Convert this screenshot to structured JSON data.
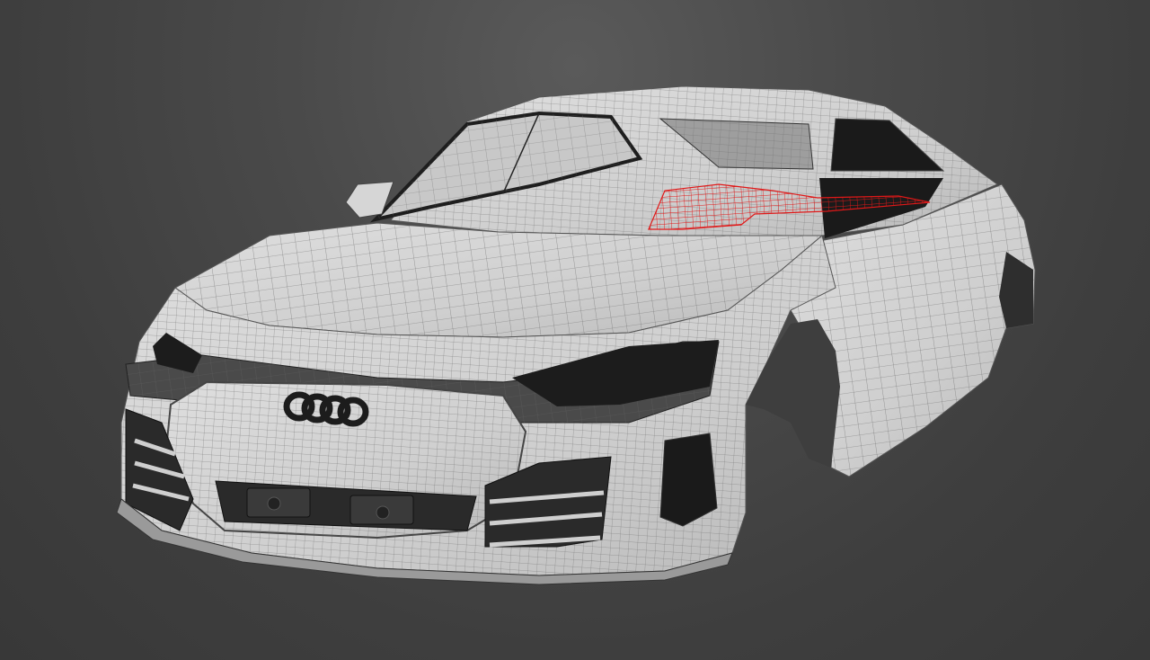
{
  "viewport": {
    "background_top": "#5a5a5a",
    "background_bottom": "#383838"
  },
  "model": {
    "shell_color": "#d3d3d3",
    "shade_color": "#a8a8a8",
    "wire_color": "#6e6e6e",
    "opening_color": "#1a1a1a",
    "selection_color": "#e01818",
    "emblem": "four-rings"
  }
}
